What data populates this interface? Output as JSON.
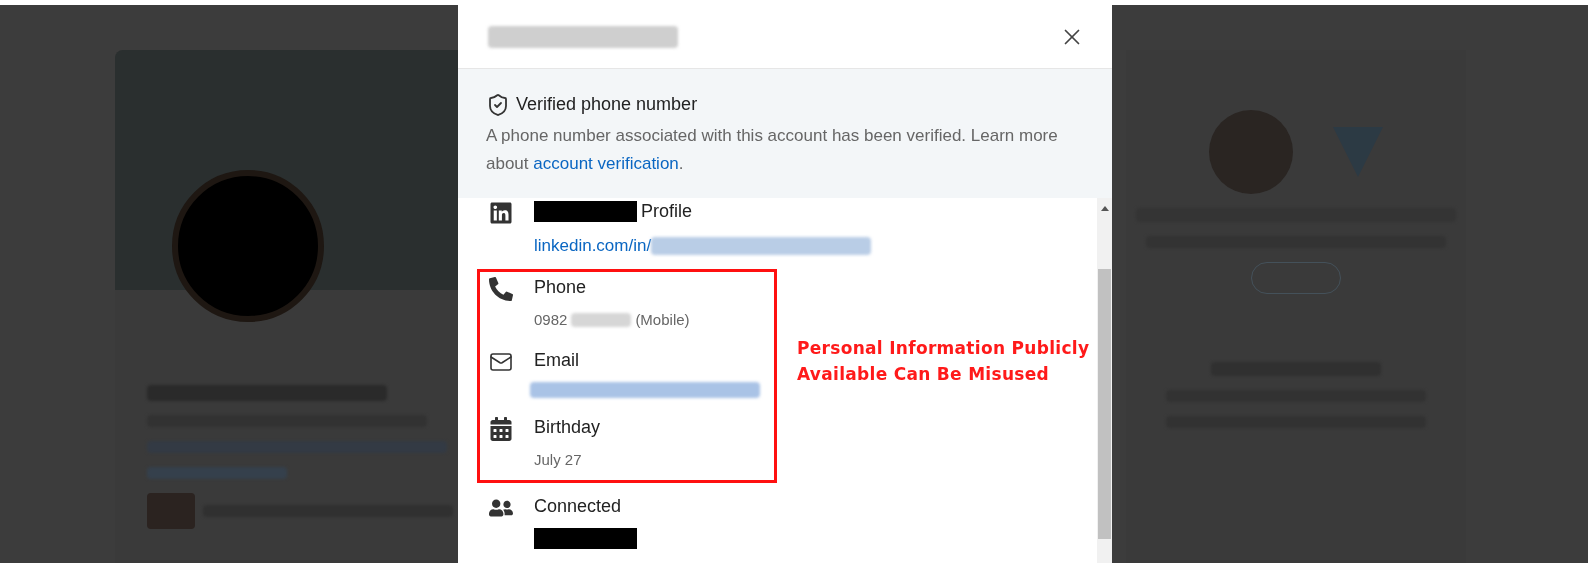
{
  "verified": {
    "title": "Verified phone number",
    "text": "A phone number associated with this account has been verified. Learn more about ",
    "link": "account verification",
    "end": "."
  },
  "items": [
    {
      "kind": "profile",
      "label": "Profile",
      "value": "linkedin.com/in/",
      "highlighted": false
    },
    {
      "kind": "phone",
      "label": "Phone",
      "value": "0982",
      "suffix": "(Mobile)",
      "highlighted": true
    },
    {
      "kind": "email",
      "label": "Email",
      "highlighted": true
    },
    {
      "kind": "birthday",
      "label": "Birthday",
      "value": "July 27",
      "highlighted": true
    },
    {
      "kind": "connected",
      "label": "Connected",
      "highlighted": false
    }
  ],
  "annotation": {
    "text": "Personal Information Publicly Available Can Be Misused"
  }
}
